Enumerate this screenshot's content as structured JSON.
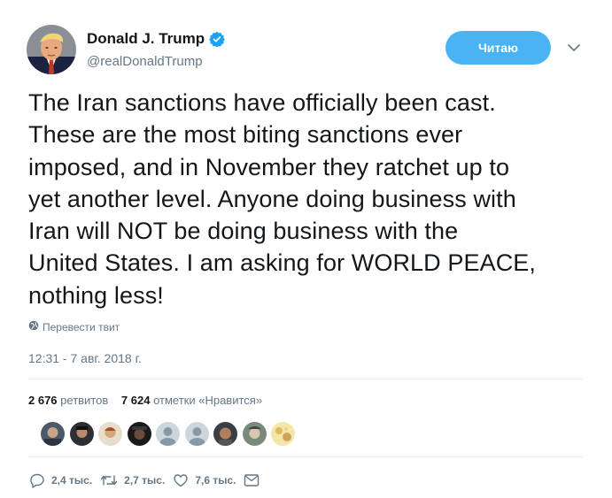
{
  "author": {
    "display_name": "Donald J. Trump",
    "handle": "@realDonaldTrump",
    "verified_icon": "verified-badge-icon",
    "avatar_icon": "avatar"
  },
  "follow_button": {
    "label": "Читаю"
  },
  "tweet": {
    "lines": [
      "The Iran sanctions have officially been cast.",
      "These are the most biting sanctions ever",
      "imposed, and in November they ratchet up to",
      "yet another level. Anyone doing business with",
      "Iran will NOT be doing business with the",
      "United States. I am asking for WORLD PEACE,",
      "nothing less!"
    ]
  },
  "translate": {
    "label": "Перевести твит",
    "icon": "globe-icon"
  },
  "timestamp": "12:31 - 7 авг. 2018 г.",
  "stats": {
    "retweets_count": "2 676",
    "retweets_label": "ретвитов",
    "likes_count": "7 624",
    "likes_label": "отметки «Нравится»"
  },
  "actions": {
    "reply_count": "2,4 тыс.",
    "retweet_count": "2,7 тыс.",
    "like_count": "7,6 тыс."
  },
  "colors": {
    "accent": "#4ab3f4",
    "verified": "#1da1f2",
    "text": "#14171a",
    "muted": "#657786",
    "divider": "#e6ecf0"
  }
}
